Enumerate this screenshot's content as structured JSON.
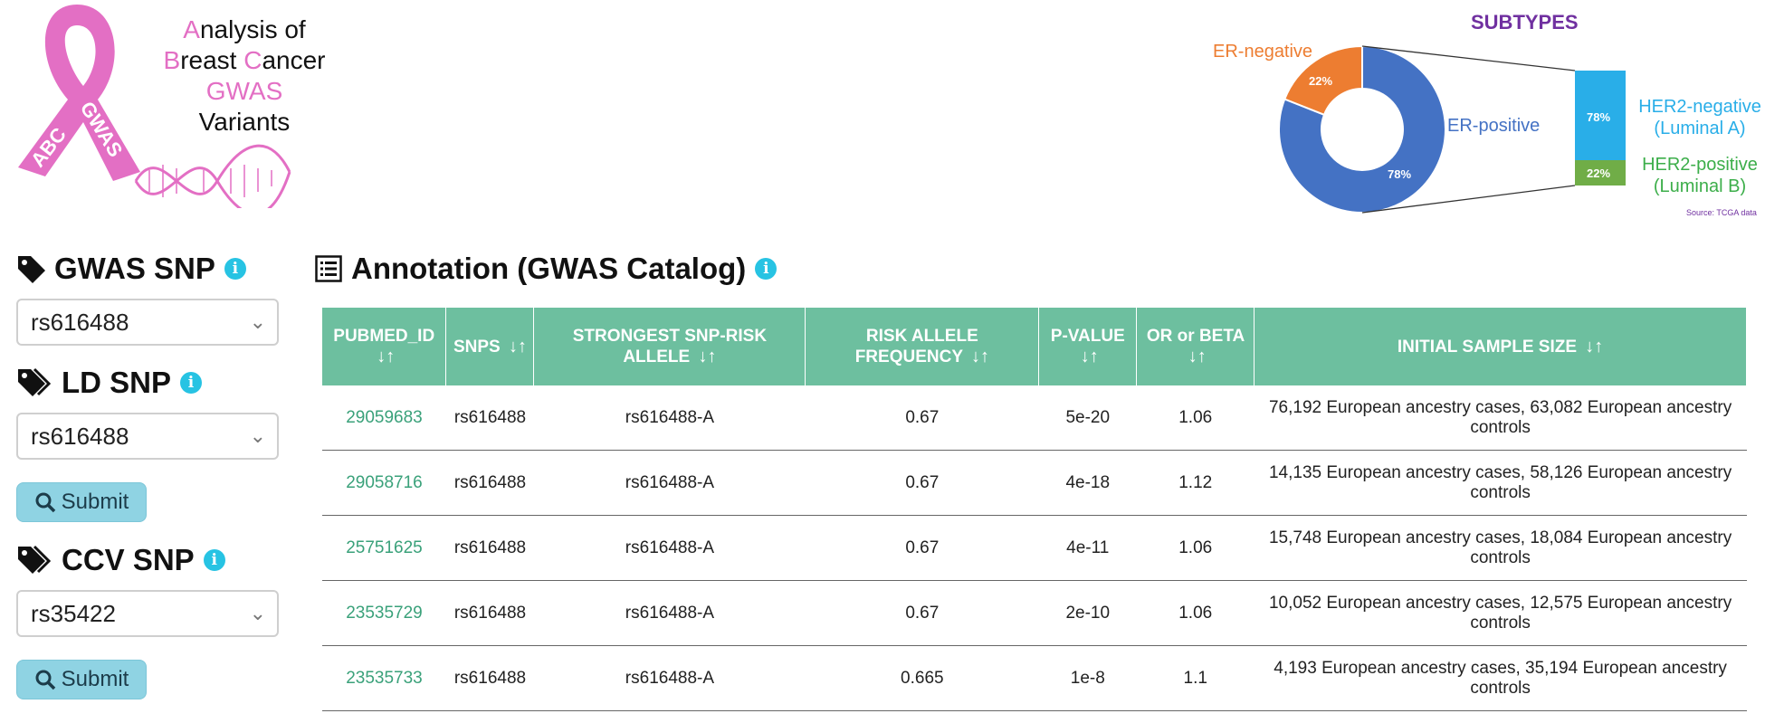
{
  "logo": {
    "line1": [
      "A",
      "nalysis of"
    ],
    "line2": [
      "B",
      "reast ",
      "C",
      "ancer"
    ],
    "line3": "GWAS",
    "line4": "Variants",
    "ribbon_left": "ABC",
    "ribbon_right": "GWAS",
    "colors": {
      "pink": "#e36fc4"
    }
  },
  "subtypes": {
    "title": "SUBTYPES",
    "er_negative_label": "ER-negative",
    "er_positive_label": "ER-positive",
    "er_negative_pct": "22%",
    "er_positive_pct": "78%",
    "her2_negative_pct": "78%",
    "her2_positive_pct": "22%",
    "her2_negative_label_1": "HER2-negative",
    "her2_negative_label_2": "(Luminal A)",
    "her2_positive_label_1": "HER2-positive",
    "her2_positive_label_2": "(Luminal B)",
    "source": "Source: TCGA data",
    "colors": {
      "er_positive": "#4472c4",
      "er_negative": "#ed7d31",
      "her2_negative": "#29aee8",
      "her2_positive": "#70ad47",
      "title": "#7030a0"
    }
  },
  "sidebar": {
    "gwas_title": "GWAS SNP",
    "gwas_value": "rs616488",
    "ld_title": "LD SNP",
    "ld_value": "rs616488",
    "submit_label": "Submit",
    "ccv_title": "CCV SNP",
    "ccv_value": "rs35422",
    "submit_label_2": "Submit"
  },
  "annotation": {
    "title": "Annotation (GWAS Catalog)",
    "columns": [
      {
        "label": "PUBMED_ID",
        "sort": "↓↑"
      },
      {
        "label": "SNPS",
        "sort": "↓↑"
      },
      {
        "label": "STRONGEST SNP-RISK ALLELE",
        "sort": "↓↑"
      },
      {
        "label": "RISK ALLELE FREQUENCY",
        "sort": "↓↑"
      },
      {
        "label": "P-VALUE",
        "sort": "↓↑"
      },
      {
        "label": "OR or BETA",
        "sort": "↓↑"
      },
      {
        "label": "INITIAL SAMPLE SIZE",
        "sort": "↓↑"
      }
    ],
    "rows": [
      [
        "29059683",
        "rs616488",
        "rs616488-A",
        "0.67",
        "5e-20",
        "1.06",
        "76,192 European ancestry cases, 63,082 European ancestry controls"
      ],
      [
        "29058716",
        "rs616488",
        "rs616488-A",
        "0.67",
        "4e-18",
        "1.12",
        "14,135 European ancestry cases, 58,126 European ancestry controls"
      ],
      [
        "25751625",
        "rs616488",
        "rs616488-A",
        "0.67",
        "4e-11",
        "1.06",
        "15,748 European ancestry cases, 18,084 European ancestry controls"
      ],
      [
        "23535729",
        "rs616488",
        "rs616488-A",
        "0.67",
        "2e-10",
        "1.06",
        "10,052 European ancestry cases, 12,575 European ancestry controls"
      ],
      [
        "23535733",
        "rs616488",
        "rs616488-A",
        "0.665",
        "1e-8",
        "1.1",
        "4,193 European ancestry cases, 35,194 European ancestry controls"
      ]
    ],
    "colors": {
      "header": "#6dbf9f",
      "link": "#3aa17a"
    }
  }
}
